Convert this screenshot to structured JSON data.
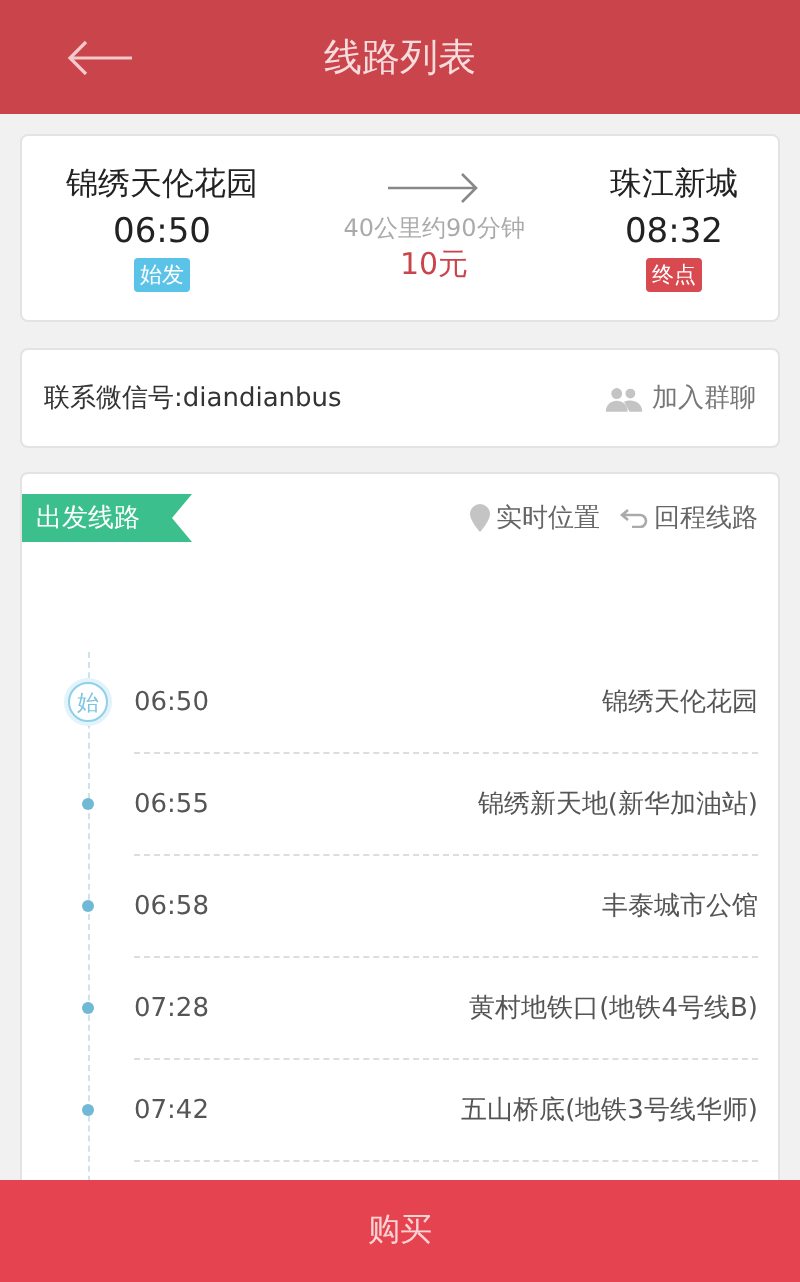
{
  "header": {
    "title": "线路列表"
  },
  "trip": {
    "origin": {
      "name": "锦绣天伦花园",
      "time": "06:50",
      "tag": "始发"
    },
    "destination": {
      "name": "珠江新城",
      "time": "08:32",
      "tag": "终点"
    },
    "distance": "40公里约90分钟",
    "price": "10元"
  },
  "contact": {
    "text": "联系微信号:diandianbus",
    "action": "加入群聊"
  },
  "route": {
    "ribbon": "出发线路",
    "actions": [
      {
        "kind": "location",
        "label": "实时位置"
      },
      {
        "kind": "return",
        "label": "回程线路"
      }
    ],
    "stops": [
      {
        "kind": "start",
        "badge": "始",
        "time": "06:50",
        "name": "锦绣天伦花园"
      },
      {
        "kind": "stop",
        "time": "06:55",
        "name": "锦绣新天地(新华加油站)"
      },
      {
        "kind": "stop",
        "time": "06:58",
        "name": "丰泰城市公馆"
      },
      {
        "kind": "stop",
        "time": "07:28",
        "name": "黄村地铁口(地铁4号线B)"
      },
      {
        "kind": "stop",
        "time": "07:42",
        "name": "五山桥底(地铁3号线华师)"
      }
    ]
  },
  "buy_button": {
    "label": "购买"
  }
}
